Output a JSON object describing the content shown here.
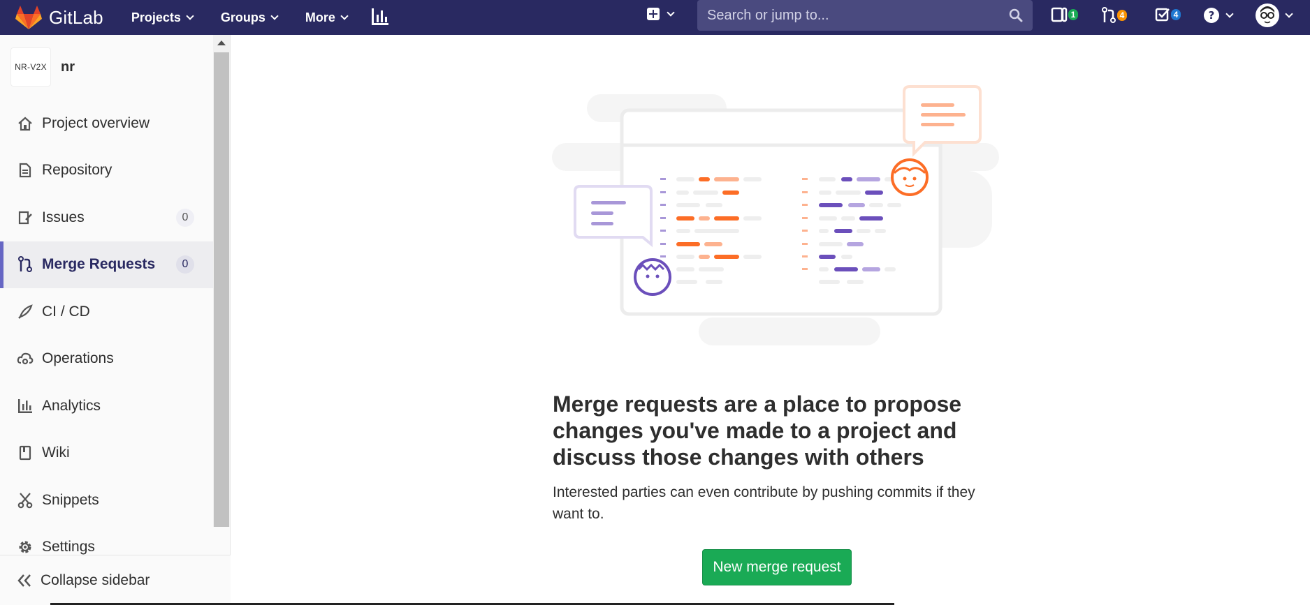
{
  "navbar": {
    "brand": "GitLab",
    "links": [
      {
        "label": "Projects"
      },
      {
        "label": "Groups"
      },
      {
        "label": "More"
      }
    ],
    "search_placeholder": "Search or jump to...",
    "issues_count": "1",
    "merge_requests_count": "4",
    "todos_count": "4"
  },
  "sidebar": {
    "project_avatar_text": "NR-V2X",
    "project_name": "nr",
    "items": [
      {
        "label": "Project overview",
        "icon": "home-icon"
      },
      {
        "label": "Repository",
        "icon": "document-icon"
      },
      {
        "label": "Issues",
        "icon": "issues-icon",
        "count": "0"
      },
      {
        "label": "Merge Requests",
        "icon": "merge-request-icon",
        "count": "0",
        "active": true
      },
      {
        "label": "CI / CD",
        "icon": "rocket-icon"
      },
      {
        "label": "Operations",
        "icon": "cloud-gear-icon"
      },
      {
        "label": "Analytics",
        "icon": "chart-icon"
      },
      {
        "label": "Wiki",
        "icon": "book-icon"
      },
      {
        "label": "Snippets",
        "icon": "scissors-icon"
      },
      {
        "label": "Settings",
        "icon": "gear-icon"
      }
    ],
    "collapse_label": "Collapse sidebar"
  },
  "main": {
    "heading": "Merge requests are a place to propose changes you've made to a project and discuss those changes with others",
    "subtext": "Interested parties can even contribute by pushing commits if they want to.",
    "new_button": "New merge request"
  },
  "colors": {
    "navbar": "#292961",
    "active_accent": "#6666c4",
    "primary_button": "#1aaa55",
    "illustration_orange": "#fc6d26",
    "illustration_purple": "#6b4fbb"
  }
}
